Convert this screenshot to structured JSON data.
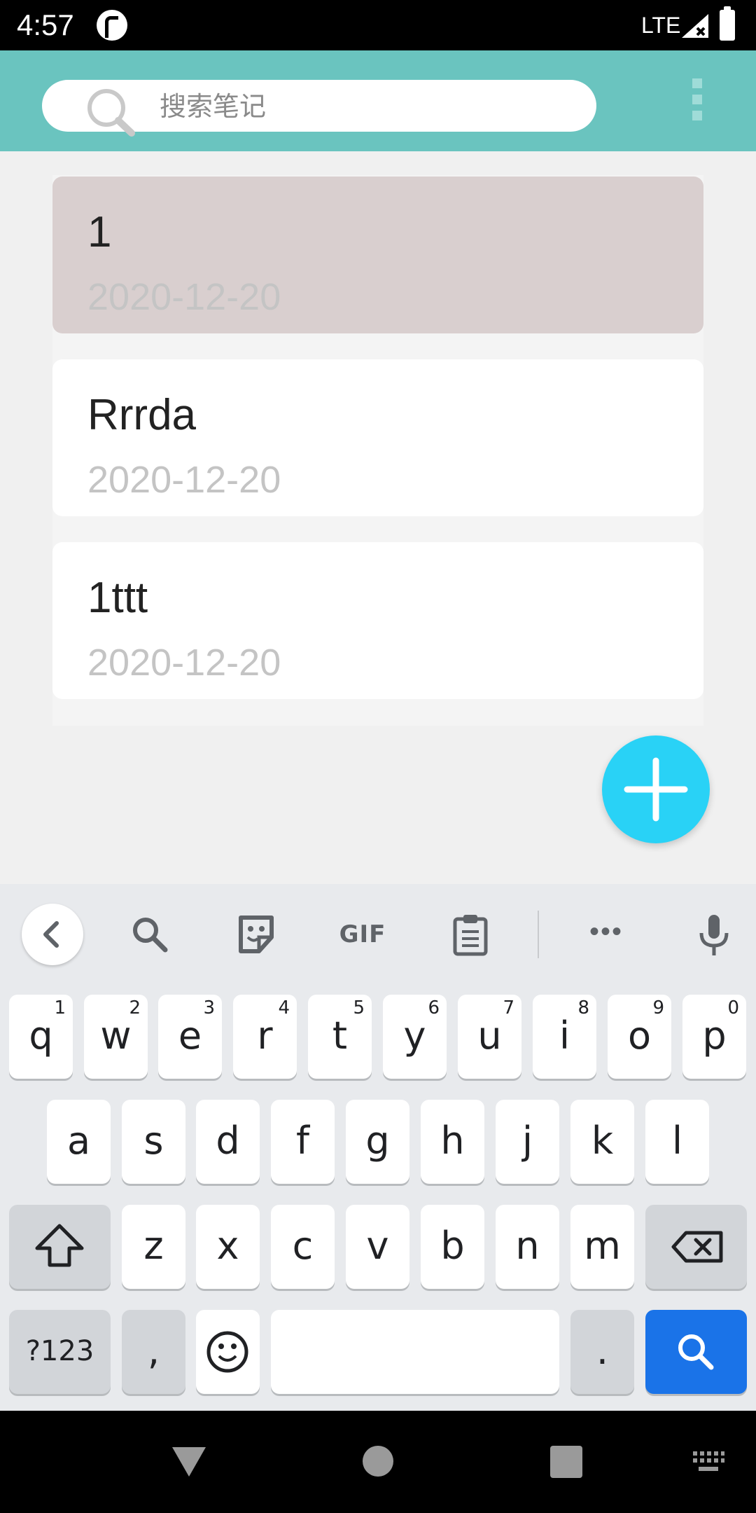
{
  "status_bar": {
    "time": "4:57",
    "network": "LTE",
    "icons": [
      "app-notification-icon",
      "signal-icon",
      "battery-icon"
    ]
  },
  "toolbar": {
    "search_placeholder": "搜索笔记",
    "menu_icon": "overflow-menu-icon",
    "background_color": "#6ac4bf"
  },
  "notes": [
    {
      "title": "1",
      "date": "2020-12-20",
      "selected": true
    },
    {
      "title": "Rrrda",
      "date": "2020-12-20",
      "selected": false
    },
    {
      "title": "1ttt",
      "date": "2020-12-20",
      "selected": false
    }
  ],
  "fab": {
    "icon": "plus-icon",
    "color": "#29d2f6"
  },
  "keyboard": {
    "toolbar": {
      "back_icon": "chevron-left-icon",
      "search_icon": "search-icon",
      "sticker_icon": "sticker-icon",
      "gif_label": "GIF",
      "clipboard_icon": "clipboard-icon",
      "more_label": "•••",
      "mic_icon": "microphone-icon"
    },
    "row1": [
      {
        "label": "q",
        "hint": "1"
      },
      {
        "label": "w",
        "hint": "2"
      },
      {
        "label": "e",
        "hint": "3"
      },
      {
        "label": "r",
        "hint": "4"
      },
      {
        "label": "t",
        "hint": "5"
      },
      {
        "label": "y",
        "hint": "6"
      },
      {
        "label": "u",
        "hint": "7"
      },
      {
        "label": "i",
        "hint": "8"
      },
      {
        "label": "o",
        "hint": "9"
      },
      {
        "label": "p",
        "hint": "0"
      }
    ],
    "row2": [
      "a",
      "s",
      "d",
      "f",
      "g",
      "h",
      "j",
      "k",
      "l"
    ],
    "row3": [
      "z",
      "x",
      "c",
      "v",
      "b",
      "n",
      "m"
    ],
    "symbols_label": "?123",
    "comma_label": ",",
    "period_label": ".",
    "action_color": "#1a73e8"
  },
  "nav_bar": {
    "icons": [
      "back-icon",
      "home-icon",
      "recents-icon",
      "keyboard-switch-icon"
    ]
  }
}
